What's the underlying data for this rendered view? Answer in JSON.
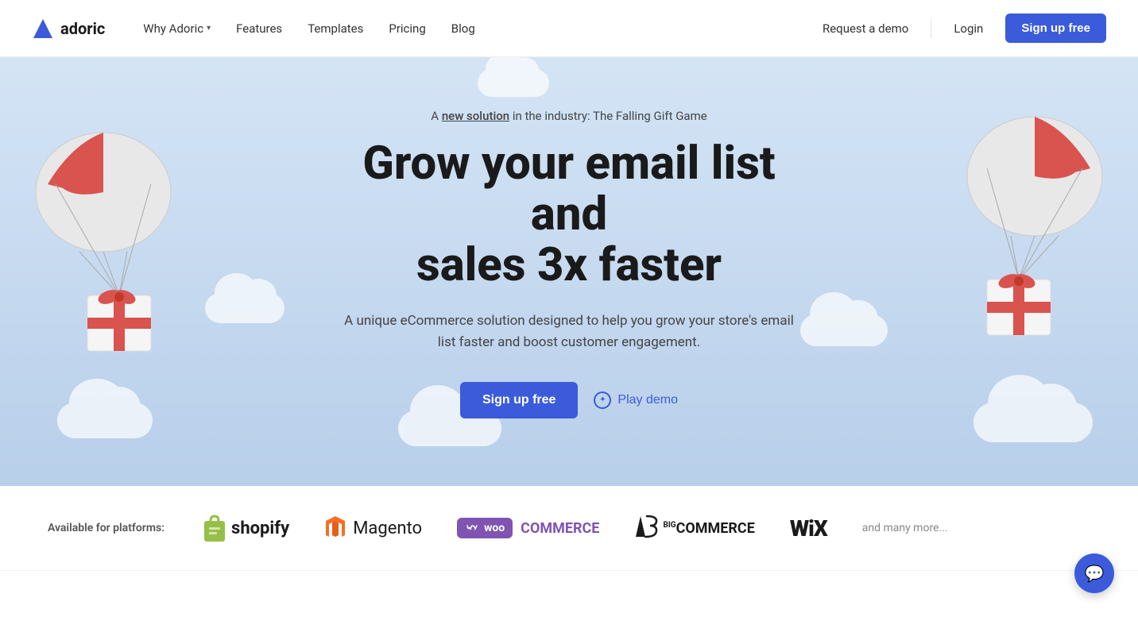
{
  "navbar": {
    "logo_text": "adoric",
    "nav": {
      "why_adoric": "Why Adoric",
      "features": "Features",
      "templates": "Templates",
      "pricing": "Pricing",
      "blog": "Blog"
    },
    "request_demo": "Request a demo",
    "login": "Login",
    "signup": "Sign up free"
  },
  "hero": {
    "announcement": "A new solution in the industry: The Falling Gift Game",
    "announcement_underline": "new solution",
    "title_line1": "Grow your email list and",
    "title_line2": "sales 3x faster",
    "subtitle": "A unique eCommerce solution designed to help you grow your store's email list faster and boost customer engagement.",
    "signup_btn": "Sign up free",
    "demo_btn": "Play demo"
  },
  "platforms": {
    "label": "Available for platforms:",
    "shopify": "shopify",
    "magento": "Magento",
    "woo": "woo",
    "commerce": "COMMERCE",
    "bigcommerce": "BigCommerce",
    "wix": "WiX",
    "more": "and many more..."
  },
  "colors": {
    "primary": "#3b5bdb",
    "hero_bg": "#c8d9f0"
  }
}
